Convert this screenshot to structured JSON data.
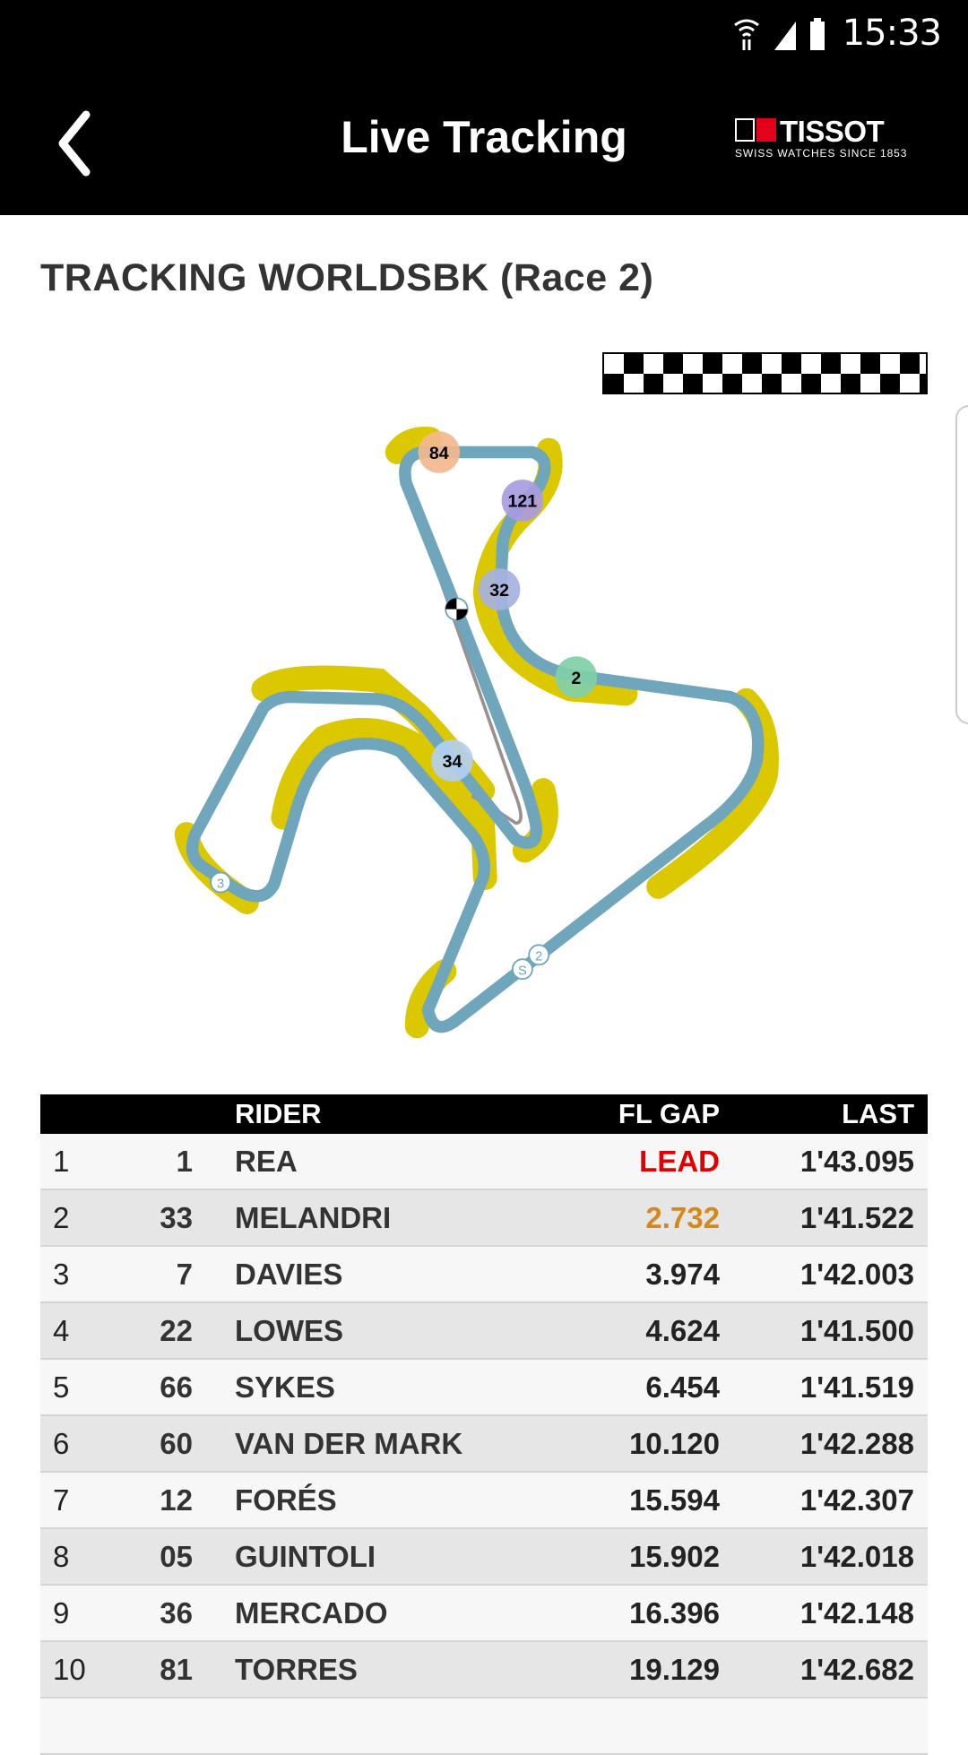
{
  "status_bar": {
    "time": "15:33",
    "icons": [
      "wifi-icon",
      "signal-icon",
      "battery-icon"
    ]
  },
  "header": {
    "title": "Live Tracking",
    "back_icon": "chevron-left-icon",
    "logo": {
      "brand": "TISSOT",
      "tagline": "SWISS WATCHES SINCE 1853"
    }
  },
  "page_title": "TRACKING WORLDSBK (Race 2)",
  "track": {
    "riders_on_track": [
      {
        "number": "84",
        "color": "#f2b98e"
      },
      {
        "number": "121",
        "color": "#a99be0"
      },
      {
        "number": "32",
        "color": "#a6b2df"
      },
      {
        "number": "2",
        "color": "#80cfa8"
      },
      {
        "number": "34",
        "color": "#b3cff0"
      }
    ],
    "sector_markers": [
      "3",
      "S",
      "2"
    ],
    "colors": {
      "track": "#6fa6bb",
      "runoff": "#dcc800"
    }
  },
  "table": {
    "headers": {
      "pos": "",
      "num": "",
      "rider": "RIDER",
      "gap": "FL GAP",
      "last": "LAST"
    },
    "rows": [
      {
        "pos": "1",
        "num": "1",
        "rider": "REA",
        "gap": "LEAD",
        "last": "1'43.095",
        "gap_color": "#e00000"
      },
      {
        "pos": "2",
        "num": "33",
        "rider": "MELANDRI",
        "gap": "2.732",
        "last": "1'41.522",
        "gap_color": "#d4891a"
      },
      {
        "pos": "3",
        "num": "7",
        "rider": "DAVIES",
        "gap": "3.974",
        "last": "1'42.003"
      },
      {
        "pos": "4",
        "num": "22",
        "rider": "LOWES",
        "gap": "4.624",
        "last": "1'41.500"
      },
      {
        "pos": "5",
        "num": "66",
        "rider": "SYKES",
        "gap": "6.454",
        "last": "1'41.519"
      },
      {
        "pos": "6",
        "num": "60",
        "rider": "VAN DER MARK",
        "gap": "10.120",
        "last": "1'42.288"
      },
      {
        "pos": "7",
        "num": "12",
        "rider": "FORÉS",
        "gap": "15.594",
        "last": "1'42.307"
      },
      {
        "pos": "8",
        "num": "05",
        "rider": "GUINTOLI",
        "gap": "15.902",
        "last": "1'42.018"
      },
      {
        "pos": "9",
        "num": "36",
        "rider": "MERCADO",
        "gap": "16.396",
        "last": "1'42.148"
      },
      {
        "pos": "10",
        "num": "81",
        "rider": "TORRES",
        "gap": "19.129",
        "last": "1'42.682"
      }
    ]
  }
}
